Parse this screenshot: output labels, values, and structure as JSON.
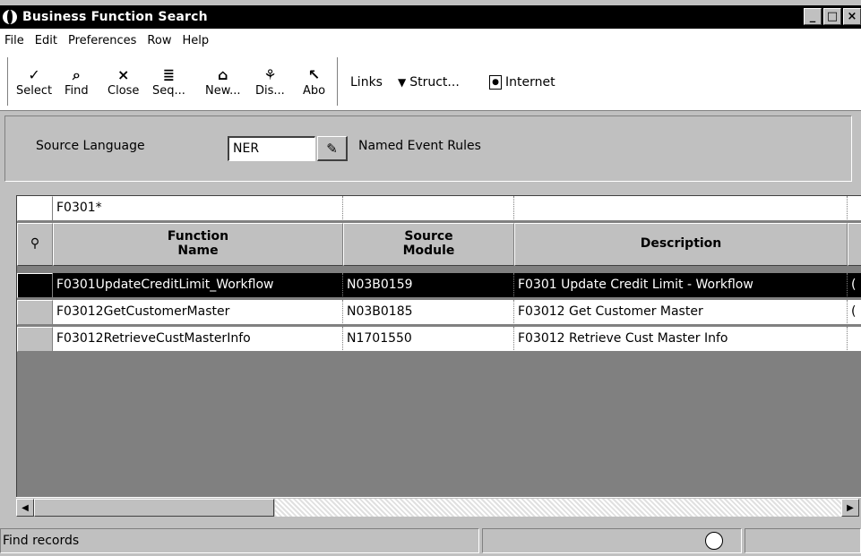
{
  "window": {
    "title": "Business Function Search",
    "buttons": {
      "minimize": "_",
      "maximize": "□",
      "close": "×"
    }
  },
  "menu": [
    "File",
    "Edit",
    "Preferences",
    "Row",
    "Help"
  ],
  "toolbar": {
    "buttons": [
      {
        "label": "Select",
        "icon": "✓"
      },
      {
        "label": "Find",
        "icon": "⌕"
      },
      {
        "label": "Close",
        "icon": "×"
      },
      {
        "label": "Seq...",
        "icon": "≣"
      },
      {
        "label": "New...",
        "icon": "⌂"
      },
      {
        "label": "Dis...",
        "icon": "⚘"
      },
      {
        "label": "Abo",
        "icon": "↖"
      }
    ],
    "links": "Links",
    "struct": "Struct...",
    "internet": "Internet"
  },
  "panel": {
    "source_language_label": "Source Language",
    "source_language_value": "NER",
    "named_event_rules": "Named Event Rules"
  },
  "grid": {
    "qbe": [
      "F0301*",
      "",
      "",
      ""
    ],
    "headers": [
      [
        "Function",
        "Name"
      ],
      [
        "Source",
        "Module"
      ],
      [
        "Description"
      ]
    ],
    "rows": [
      {
        "name": "F0301UpdateCreditLimit_Workflow",
        "module": "N03B0159",
        "desc": "F0301 Update Credit Limit - Workflow",
        "extra": "(",
        "selected": true
      },
      {
        "name": "F03012GetCustomerMaster",
        "module": "N03B0185",
        "desc": "F03012 Get Customer Master",
        "extra": "(",
        "selected": false
      },
      {
        "name": "F03012RetrieveCustMasterInfo",
        "module": "N1701550",
        "desc": "F03012 Retrieve Cust Master Info",
        "extra": "",
        "selected": false
      }
    ]
  },
  "status": {
    "text": "Find records"
  }
}
